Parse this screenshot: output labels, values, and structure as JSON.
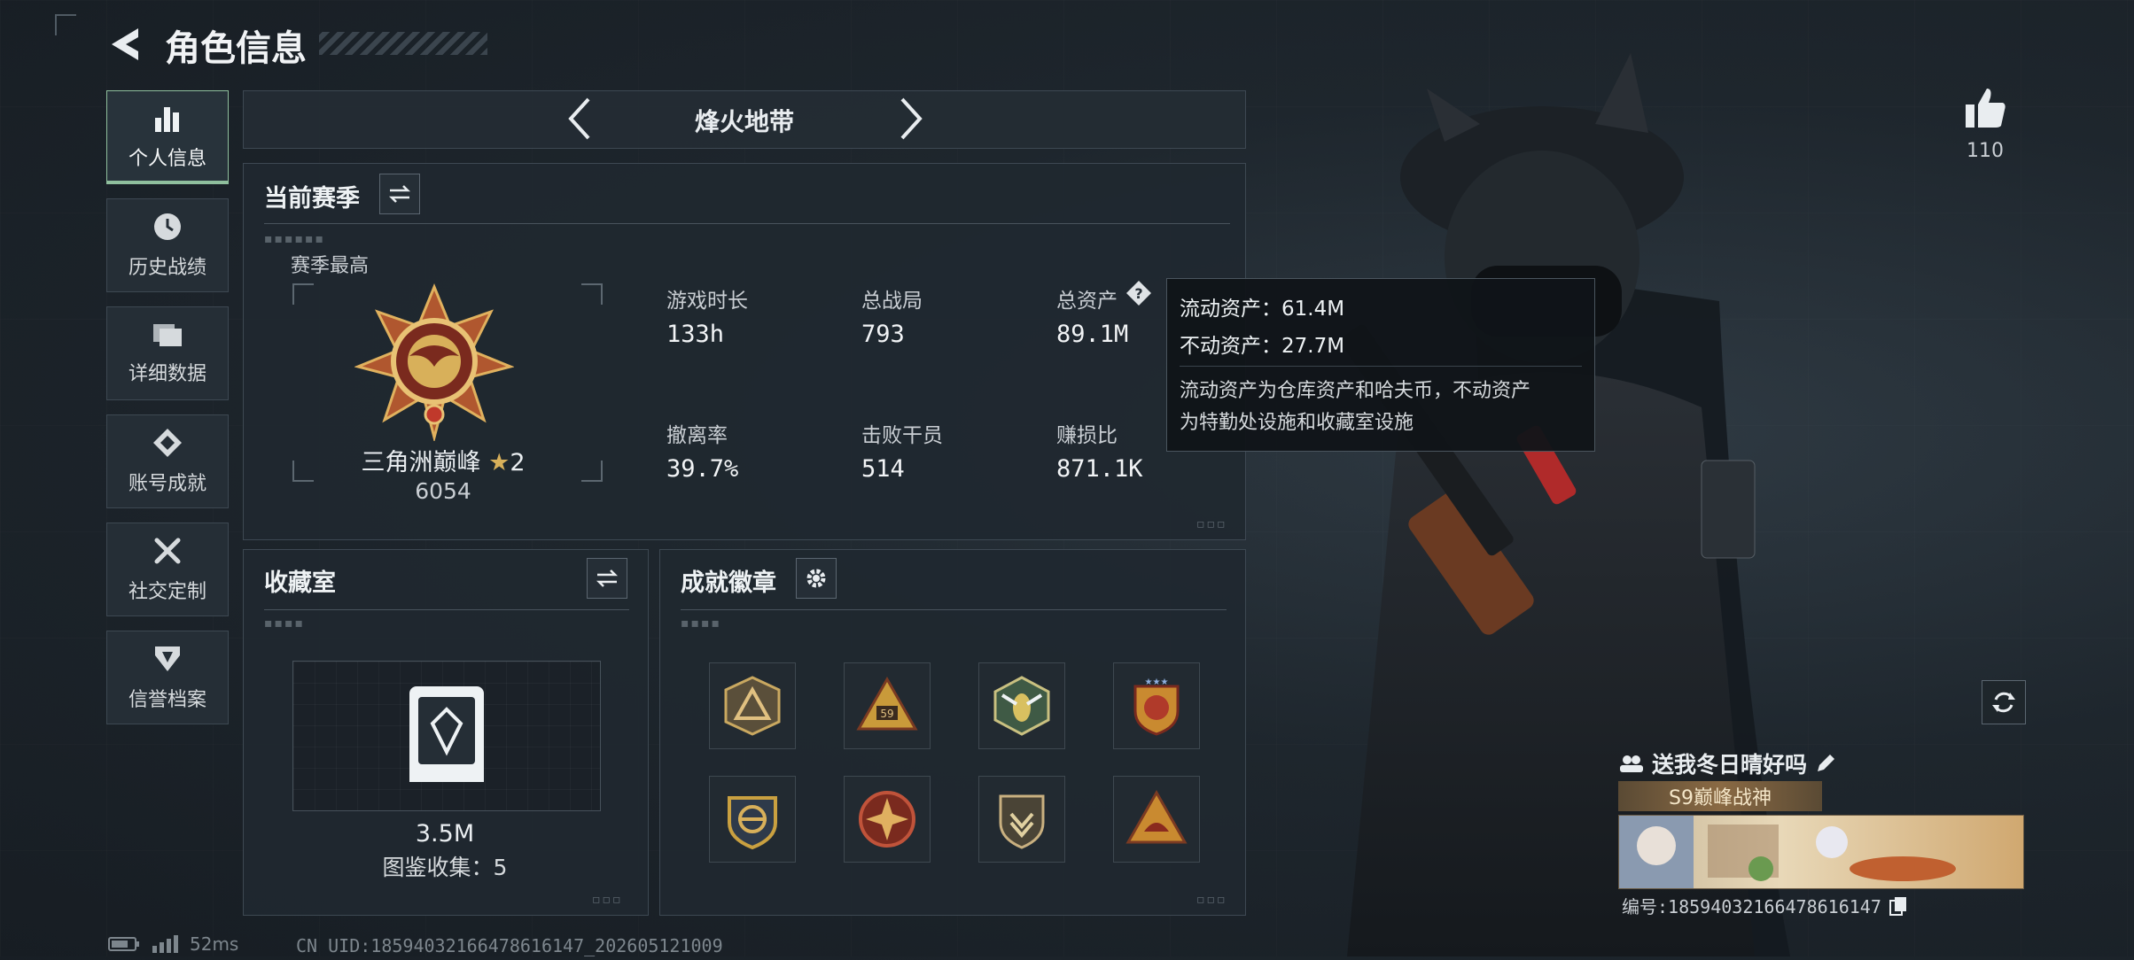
{
  "header": {
    "title": "角色信息"
  },
  "nav": [
    {
      "label": "个人信息",
      "icon": "bar-chart-icon",
      "active": true
    },
    {
      "label": "历史战绩",
      "icon": "clock-icon"
    },
    {
      "label": "详细数据",
      "icon": "folder-icon"
    },
    {
      "label": "账号成就",
      "icon": "achievement-icon"
    },
    {
      "label": "社交定制",
      "icon": "tools-icon"
    },
    {
      "label": "信誉档案",
      "icon": "shield-icon"
    }
  ],
  "mode_selector": {
    "label": "烽火地带"
  },
  "season": {
    "title": "当前赛季",
    "best_label": "赛季最高",
    "rank_name": "三角洲巅峰",
    "rank_stars": "2",
    "rank_points": "6054",
    "stats": [
      {
        "label": "游戏时长",
        "value": "133h"
      },
      {
        "label": "总战局",
        "value": "793"
      },
      {
        "label": "总资产",
        "value": "89.1M"
      },
      {
        "label": "撤离率",
        "value": "39.7%"
      },
      {
        "label": "击败干员",
        "value": "514"
      },
      {
        "label": "赚损比",
        "value": "871.1K"
      }
    ]
  },
  "tooltip": {
    "liquid": "流动资产：61.4M",
    "fixed": "不动资产：27.7M",
    "desc_line1": "流动资产为仓库资产和哈夫币，不动资产",
    "desc_line2": "为特勤处设施和收藏室设施"
  },
  "collection": {
    "title": "收藏室",
    "value": "3.5M",
    "count_text": "图鉴收集：5"
  },
  "achievements": {
    "title": "成就徽章",
    "badges": [
      {
        "icon": "pyramid-badge-icon",
        "color": "#8a7a55"
      },
      {
        "icon": "triangle-59-badge-icon",
        "color": "#c99a3a"
      },
      {
        "icon": "wasp-badge-icon",
        "color": "#6f8b63"
      },
      {
        "icon": "stars-crest-badge-icon",
        "color": "#c98a30"
      },
      {
        "icon": "anchor-crest-badge-icon",
        "color": "#c9a040"
      },
      {
        "icon": "compass-star-badge-icon",
        "color": "#c0533a"
      },
      {
        "icon": "wings-badge-icon",
        "color": "#a99360"
      },
      {
        "icon": "sail-triangle-badge-icon",
        "color": "#c98a30"
      }
    ]
  },
  "likes": {
    "count": "110"
  },
  "profile": {
    "signature": "送我冬日晴好吗",
    "title_tag": "S9巅峰战神",
    "id_text": "编号:18594032166478616147"
  },
  "status_bar": {
    "ping": "52ms",
    "uid": "CN UID:18594032166478616147_202605121009"
  },
  "colors": {
    "accent_gold": "#d8b05a",
    "panel": "#202830",
    "border": "#3d4852",
    "active_nav": "#8fbf9d"
  }
}
